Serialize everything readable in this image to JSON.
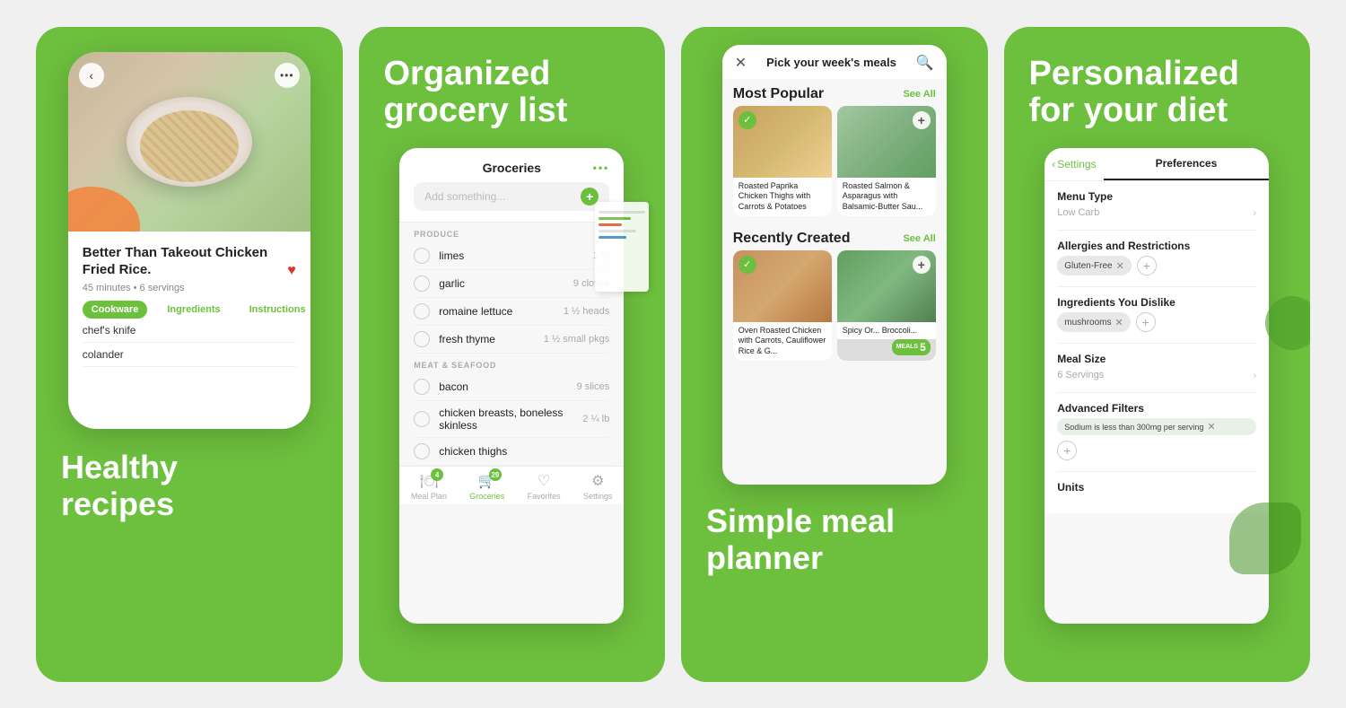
{
  "card1": {
    "headline": "Healthy\nrecipes",
    "recipe_title": "Better Than Takeout Chicken Fried Rice.",
    "recipe_meta": "45 minutes • 6 servings",
    "tabs": [
      "Cookware",
      "Ingredients",
      "Instructions"
    ],
    "active_tab": "Cookware",
    "items": [
      "chef's knife",
      "colander"
    ]
  },
  "card2": {
    "headline": "Organized\ngrocery list",
    "grocery_title": "Groceries",
    "search_placeholder": "Add something...",
    "sections": [
      {
        "label": "PRODUCE",
        "items": [
          {
            "name": "limes",
            "qty": "1 ½"
          },
          {
            "name": "garlic",
            "qty": "9 cloves"
          },
          {
            "name": "romaine lettuce",
            "qty": "1 ½ heads"
          },
          {
            "name": "fresh thyme",
            "qty": "1 ½ small pkgs"
          }
        ]
      },
      {
        "label": "MEAT & SEAFOOD",
        "items": [
          {
            "name": "bacon",
            "qty": "9 slices"
          },
          {
            "name": "chicken breasts, boneless skinless",
            "qty": "2 ¼ lb"
          },
          {
            "name": "chicken thighs",
            "qty": ""
          }
        ]
      }
    ],
    "nav_items": [
      {
        "label": "Meal Plan",
        "icon": "🍽",
        "badge": "4",
        "active": false
      },
      {
        "label": "Groceries",
        "icon": "🛒",
        "badge": "29",
        "active": true
      },
      {
        "label": "Favorites",
        "icon": "♡",
        "badge": "",
        "active": false
      },
      {
        "label": "Settings",
        "icon": "⚙",
        "badge": "",
        "active": false
      }
    ]
  },
  "card3": {
    "modal_title": "Pick your week's meals",
    "most_popular_label": "Most Popular",
    "see_all": "See All",
    "recently_created_label": "Recently Created",
    "meals": [
      {
        "label": "Roasted Paprika Chicken Thighs with Carrots & Potatoes",
        "checked": true
      },
      {
        "label": "Roasted Salmon & Asparagus with Balsamic-Butter Sau...",
        "checked": false
      }
    ],
    "recent_meals": [
      {
        "label": "Oven Roasted Chicken with Carrots, Cauliflower Rice & G...",
        "checked": true
      },
      {
        "label": "Spicy Or... Broccoli...",
        "checked": false
      }
    ],
    "meals_count": "5",
    "headline1": "Simple meal",
    "headline2": "planner"
  },
  "card4": {
    "headline1": "Personalized",
    "headline2": "for your diet",
    "settings_label": "Settings",
    "preferences_label": "Preferences",
    "menu_type_label": "Menu Type",
    "menu_type_value": "Low Carb",
    "allergies_label": "Allergies and Restrictions",
    "allergy_tags": [
      "Gluten-Free"
    ],
    "dislike_label": "Ingredients You Dislike",
    "dislike_tags": [
      "mushrooms"
    ],
    "meal_size_label": "Meal Size",
    "meal_size_value": "6 Servings",
    "advanced_label": "Advanced Filters",
    "advanced_filter": "Sodium is less than 300mg per serving",
    "units_label": "Units"
  }
}
